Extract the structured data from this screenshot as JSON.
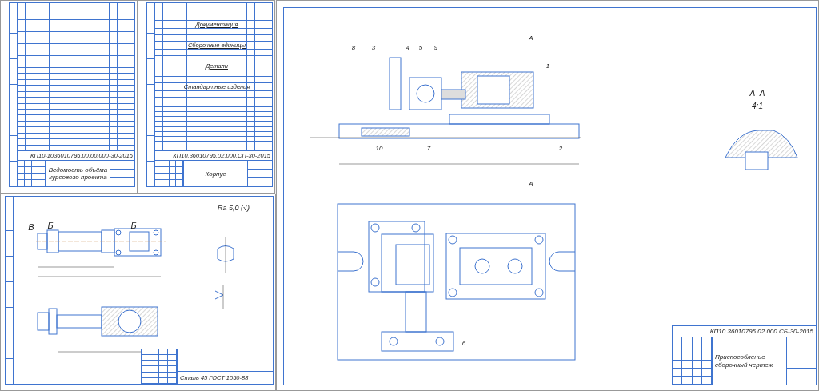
{
  "statement_sheet": {
    "code": "КП10-1036010795.00.00.000-30-2015",
    "title": "Ведомость объёма курсового проекта"
  },
  "spec_sheet": {
    "sections": [
      "Документация",
      "Сборочные единицы",
      "Детали",
      "Стандартные изделия"
    ],
    "code": "КП10.36010795.02.000.СП-30-2015",
    "title": "Корпус"
  },
  "part_sheet": {
    "roughness": "Ra 5,0 (√)",
    "labels": [
      "В",
      "Б",
      "Б"
    ],
    "material": "Сталь 45 ГОСТ 1050-88"
  },
  "assembly_sheet": {
    "labels": [
      "8",
      "3",
      "4",
      "5",
      "9",
      "1",
      "10",
      "7",
      "2",
      "А",
      "А",
      "6"
    ],
    "section_title": "А–А",
    "section_scale": "4:1",
    "code": "КП10.36010795.02.000.СБ-30-2015",
    "title": "Приспособление сборочный чертеж"
  }
}
